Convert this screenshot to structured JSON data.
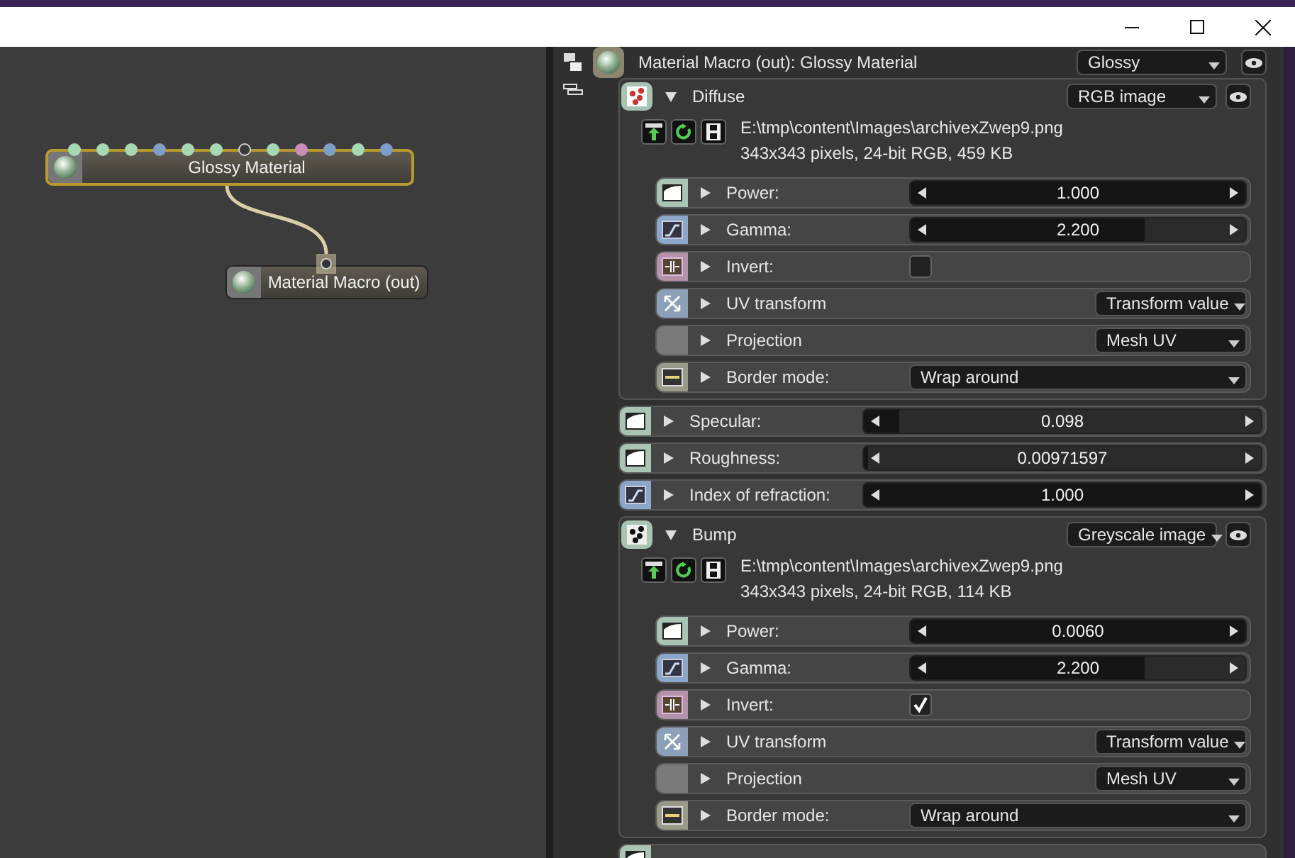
{
  "node_graph": {
    "nodes": [
      {
        "title": "Glossy Material",
        "selected": true,
        "pins": [
          {
            "color": "#a6d8b4",
            "linked": false
          },
          {
            "color": "#a6d8b4",
            "linked": false
          },
          {
            "color": "#a6d8b4",
            "linked": false
          },
          {
            "color": "#7f9fc8",
            "linked": false
          },
          {
            "color": "#a6d8b4",
            "linked": false
          },
          {
            "color": "#a6d8b4",
            "linked": false
          },
          {
            "color": "#d0d0d0",
            "linked": true
          },
          {
            "color": "#a6d8b4",
            "linked": false
          },
          {
            "color": "#c890b8",
            "linked": false
          },
          {
            "color": "#7f9fc8",
            "linked": false
          },
          {
            "color": "#a6d8b4",
            "linked": false
          },
          {
            "color": "#7f9fc8",
            "linked": false
          }
        ]
      },
      {
        "title": "Material Macro (out)",
        "selected": false
      }
    ]
  },
  "inspector": {
    "title": "Material Macro (out): Glossy Material",
    "type": "Glossy",
    "items": [
      {
        "kind": "group",
        "label": "Diffuse",
        "expanded": true,
        "type": "RGB image",
        "file": "E:\\tmp\\content\\Images\\archivexZwep9.png",
        "info": "343x343 pixels, 24-bit RGB, 459 KB",
        "params": [
          {
            "kind": "slider",
            "label": "Power:",
            "value": "1.000",
            "level": 1,
            "expanded": false
          },
          {
            "kind": "slider",
            "label": "Gamma:",
            "value": "2.200",
            "level": 0.7,
            "expanded": false
          },
          {
            "kind": "checkbox",
            "label": "Invert:",
            "checked": false,
            "expanded": false
          },
          {
            "kind": "dropdown",
            "label": "UV transform",
            "value": "Transform value",
            "expanded": false
          },
          {
            "kind": "dropdown",
            "label": "Projection",
            "value": "Mesh UV",
            "expanded": false
          },
          {
            "kind": "enum",
            "label": "Border mode:",
            "value": "Wrap around",
            "expanded": false
          }
        ]
      },
      {
        "kind": "slider",
        "label": "Specular:",
        "value": "0.098",
        "level": 0.09,
        "expanded": false
      },
      {
        "kind": "slider",
        "label": "Roughness:",
        "value": "0.00971597",
        "level": 0.01,
        "expanded": false
      },
      {
        "kind": "slider",
        "label": "Index of refraction:",
        "value": "1.000",
        "level": 1,
        "expanded": false
      },
      {
        "kind": "group",
        "label": "Bump",
        "expanded": true,
        "type": "Greyscale image",
        "file": "E:\\tmp\\content\\Images\\archivexZwep9.png",
        "info": "343x343 pixels, 24-bit RGB, 114 KB",
        "params": [
          {
            "kind": "slider",
            "label": "Power:",
            "value": "0.0060",
            "level": 1,
            "expanded": false
          },
          {
            "kind": "slider",
            "label": "Gamma:",
            "value": "2.200",
            "level": 0.7,
            "expanded": false
          },
          {
            "kind": "checkbox",
            "label": "Invert:",
            "checked": true,
            "expanded": false
          },
          {
            "kind": "dropdown",
            "label": "UV transform",
            "value": "Transform value",
            "expanded": false
          },
          {
            "kind": "dropdown",
            "label": "Projection",
            "value": "Mesh UV",
            "expanded": false
          },
          {
            "kind": "enum",
            "label": "Border mode:",
            "value": "Wrap around",
            "expanded": false
          }
        ]
      }
    ]
  }
}
